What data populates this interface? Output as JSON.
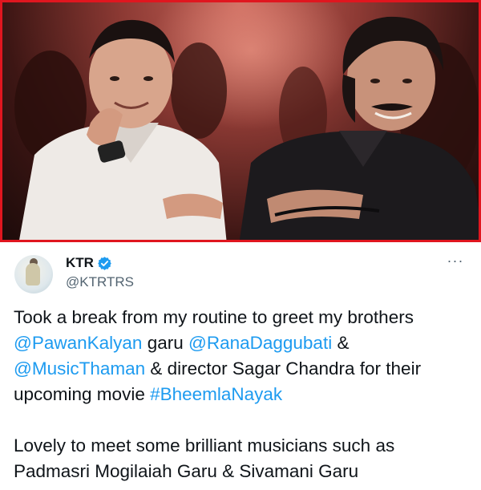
{
  "photo": {
    "alt_icon": "photo-image",
    "border_color": "#e0161f"
  },
  "author": {
    "display_name": "KTR",
    "handle": "@KTRTRS",
    "verified_icon": "verified-badge-icon",
    "more_label": "···"
  },
  "tweet": {
    "paragraph1": {
      "t1": "Took a break from my routine to greet my brothers",
      "m1": "@PawanKalyan",
      "t2": " garu ",
      "m2": "@RanaDaggubati",
      "t3": " &",
      "m3": "@MusicThaman",
      "t4": " & director Sagar Chandra for their upcoming movie ",
      "h1": "#BheemlaNayak"
    },
    "paragraph2": {
      "line1": "Lovely to meet some brilliant musicians such as",
      "line2": "Padmasri Mogilaiah Garu & Sivamani Garu"
    }
  },
  "colors": {
    "link": "#1d9bf0",
    "text": "#0f1419",
    "muted": "#536471",
    "verified": "#1d9bf0"
  }
}
